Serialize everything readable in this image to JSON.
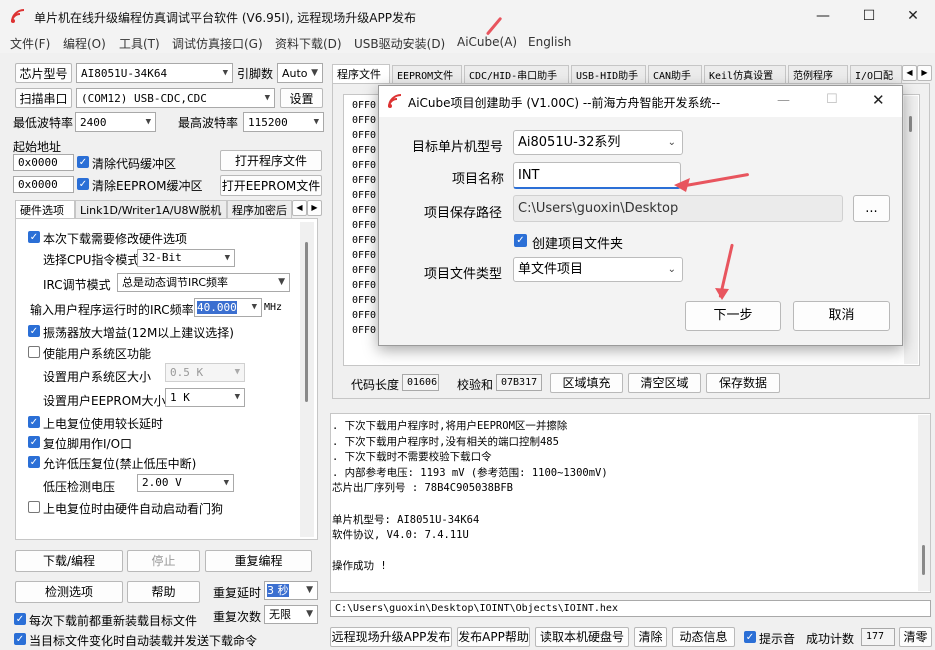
{
  "app": {
    "title": "单片机在线升级编程仿真调试平台软件 (V6.95I), 远程现场升级APP发布",
    "window_buttons": [
      "—",
      "☐",
      "✕"
    ]
  },
  "menu": [
    "文件(F)",
    "编程(O)",
    "工具(T)",
    "调试仿真接口(G)",
    "资料下载(D)",
    "USB驱动安装(D)",
    "AiCube(A)",
    "English"
  ],
  "left": {
    "chip_label": "芯片型号",
    "chip_value": "AI8051U-34K64",
    "pins_label": "引脚数",
    "pins_value": "Auto",
    "scan_label": "扫描串口",
    "port_value": "(COM12) USB-CDC,CDC",
    "settings_label": "设置",
    "min_baud_label": "最低波特率",
    "min_baud_value": "2400",
    "max_baud_label": "最高波特率",
    "max_baud_value": "115200",
    "start_addr_label": "起始地址",
    "addr1": "0x0000",
    "clear_code_label": "清除代码缓冲区",
    "open_prog_label": "打开程序文件",
    "addr2": "0x0000",
    "clear_eeprom_label": "清除EEPROM缓冲区",
    "open_eeprom_label": "打开EEPROM文件",
    "tabs": [
      "硬件选项",
      "Link1D/Writer1A/U8W脱机",
      "程序加密后"
    ],
    "hw": {
      "modify_hw": "本次下载需要修改硬件选项",
      "cpu_mode_label": "选择CPU指令模式",
      "cpu_mode_value": "32-Bit",
      "irc_mode_label": "IRC调节模式",
      "irc_mode_value": "总是动态调节IRC频率",
      "irc_freq_label": "输入用户程序运行时的IRC频率",
      "irc_freq_value": "40.000",
      "irc_freq_unit": "MHz",
      "osc_gain": "振荡器放大增益(12M以上建议选择)",
      "user_sys": "使能用户系统区功能",
      "user_sys_size_label": "设置用户系统区大小",
      "user_sys_size_value": "0.5 K",
      "user_eeprom_label": "设置用户EEPROM大小",
      "user_eeprom_value": "1   K",
      "power_delay": "上电复位使用较长延时",
      "reset_pin": "复位脚用作I/O口",
      "lvr": "允许低压复位(禁止低压中断)",
      "lvd_label": "低压检测电压",
      "lvd_value": "2.00 V",
      "wdt": "上电复位时由硬件自动启动看门狗"
    },
    "download_label": "下载/编程",
    "stop_label": "停止",
    "reprogram_label": "重复编程",
    "detect_label": "检测选项",
    "help_label": "帮助",
    "repeat_delay_label": "重复延时",
    "repeat_delay_value": "3 秒",
    "repeat_count_label": "重复次数",
    "repeat_count_value": "无限",
    "reload_each": "每次下载前都重新装载目标文件",
    "auto_send": "当目标文件变化时自动装载并发送下载命令"
  },
  "right": {
    "tabs": [
      "程序文件",
      "EEPROM文件",
      "CDC/HID-串口助手",
      "USB-HID助手",
      "CAN助手",
      "Keil仿真设置",
      "范例程序",
      "I/O口配"
    ],
    "code_lines": [
      "0FF0",
      "0FF0",
      "0FF0",
      "0FF0",
      "0FF0",
      "0FF0",
      "0FF0",
      "0FF0",
      "0FF0",
      "0FF0",
      "0FF0",
      "0FF0",
      "0FF0",
      "0FF0",
      "0FF0",
      "0FF0"
    ],
    "code_len_label": "代码长度",
    "code_len_value": "01606",
    "checksum_label": "校验和",
    "checksum_value": "07B317",
    "fill_label": "区域填充",
    "clear_label": "清空区域",
    "save_label": "保存数据",
    "log_lines": [
      ". 下次下载用户程序时,将用户EEPROM区一并擦除",
      ". 下次下载用户程序时,没有相关的端口控制485",
      ". 下次下载时不需要校验下载口令",
      ". 内部参考电压: 1193 mV (参考范围: 1100~1300mV)",
      "芯片出厂序列号 : 78B4C905038BFB",
      "",
      "  单片机型号: AI8051U-34K64",
      "  软件协议, V4.0: 7.4.11U",
      "",
      "操作成功 !"
    ],
    "file_path": "C:\\Users\\guoxin\\Desktop\\IOINT\\Objects\\IOINT.hex",
    "bottom": {
      "publish_app": "远程现场升级APP发布",
      "publish_help": "发布APP帮助",
      "read_disk": "读取本机硬盘号",
      "clear": "清除",
      "dynamic": "动态信息",
      "beep_label": "提示音",
      "success_label": "成功计数",
      "success_value": "177",
      "reset_count": "清零"
    }
  },
  "dialog": {
    "title": "AiCube项目创建助手 (V1.00C) --前海方舟智能开发系统--",
    "mcu_label": "目标单片机型号",
    "mcu_value": "Ai8051U-32系列",
    "name_label": "项目名称",
    "name_value": "INT",
    "path_label": "项目保存路径",
    "path_value": "C:\\Users\\guoxin\\Desktop",
    "browse_label": "...",
    "create_folder": "创建项目文件夹",
    "type_label": "项目文件类型",
    "type_value": "单文件项目",
    "next_label": "下一步",
    "cancel_label": "取消"
  },
  "colors": {
    "accent": "#2b6fd6",
    "annotation": "#e8555e",
    "selection": "#3b6fd0"
  }
}
